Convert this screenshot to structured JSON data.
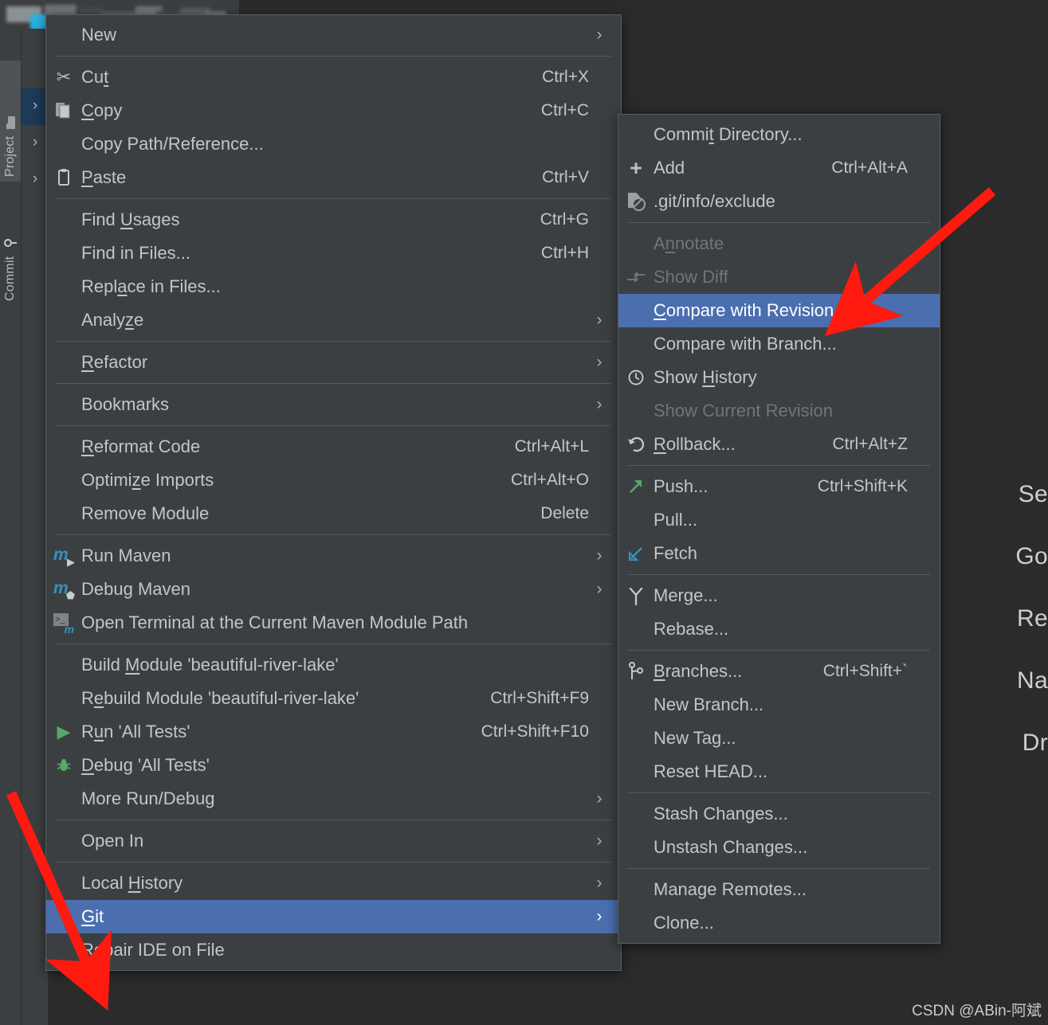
{
  "app": {
    "background_color": "#2b2b2b",
    "menu_background": "#3c3f41",
    "highlight_color": "#4b6eaf",
    "text_color": "#bfc6cc",
    "disabled_color": "#6e7579",
    "annotation_color": "#ff1a0f"
  },
  "sidebar": {
    "tool_windows": [
      {
        "label": "Project",
        "icon": "folder-icon",
        "selected": true
      },
      {
        "label": "Commit",
        "icon": "commit-icon",
        "selected": false
      }
    ],
    "tree_chevrons": [
      "›",
      "›",
      "›"
    ]
  },
  "editor": {
    "hints": [
      "Se",
      "Go",
      "Re",
      "Na",
      "Dr"
    ]
  },
  "watermark": "CSDN @ABin-阿斌",
  "context_menu": {
    "name": "project-context-menu",
    "groups": [
      {
        "items": [
          {
            "label": "New",
            "accel": "",
            "icon": "",
            "submenu": true,
            "mnemonic": "",
            "state": "normal"
          }
        ]
      },
      {
        "items": [
          {
            "label": "Cut",
            "accel": "Ctrl+X",
            "icon": "scissors-icon",
            "submenu": false,
            "mnemonic": "t",
            "state": "normal"
          },
          {
            "label": "Copy",
            "accel": "Ctrl+C",
            "icon": "copy-icon",
            "submenu": false,
            "mnemonic": "C",
            "state": "normal"
          },
          {
            "label": "Copy Path/Reference...",
            "accel": "",
            "icon": "",
            "submenu": false,
            "mnemonic": "",
            "state": "normal"
          },
          {
            "label": "Paste",
            "accel": "Ctrl+V",
            "icon": "paste-icon",
            "submenu": false,
            "mnemonic": "P",
            "state": "normal"
          }
        ]
      },
      {
        "items": [
          {
            "label": "Find Usages",
            "accel": "Ctrl+G",
            "icon": "",
            "submenu": false,
            "mnemonic": "U",
            "state": "normal"
          },
          {
            "label": "Find in Files...",
            "accel": "Ctrl+H",
            "icon": "",
            "submenu": false,
            "mnemonic": "",
            "state": "normal"
          },
          {
            "label": "Replace in Files...",
            "accel": "",
            "icon": "",
            "submenu": false,
            "mnemonic": "a",
            "state": "normal"
          },
          {
            "label": "Analyze",
            "accel": "",
            "icon": "",
            "submenu": true,
            "mnemonic": "z",
            "state": "normal"
          }
        ]
      },
      {
        "items": [
          {
            "label": "Refactor",
            "accel": "",
            "icon": "",
            "submenu": true,
            "mnemonic": "R",
            "state": "normal"
          }
        ]
      },
      {
        "items": [
          {
            "label": "Bookmarks",
            "accel": "",
            "icon": "",
            "submenu": true,
            "mnemonic": "",
            "state": "normal"
          }
        ]
      },
      {
        "items": [
          {
            "label": "Reformat Code",
            "accel": "Ctrl+Alt+L",
            "icon": "",
            "submenu": false,
            "mnemonic": "R",
            "state": "normal"
          },
          {
            "label": "Optimize Imports",
            "accel": "Ctrl+Alt+O",
            "icon": "",
            "submenu": false,
            "mnemonic": "z",
            "state": "normal"
          },
          {
            "label": "Remove Module",
            "accel": "Delete",
            "icon": "",
            "submenu": false,
            "mnemonic": "",
            "state": "normal"
          }
        ]
      },
      {
        "items": [
          {
            "label": "Run Maven",
            "accel": "",
            "icon": "maven-run-icon",
            "submenu": true,
            "mnemonic": "",
            "state": "normal"
          },
          {
            "label": "Debug Maven",
            "accel": "",
            "icon": "maven-debug-icon",
            "submenu": true,
            "mnemonic": "",
            "state": "normal"
          },
          {
            "label": "Open Terminal at the Current Maven Module Path",
            "accel": "",
            "icon": "maven-terminal-icon",
            "submenu": false,
            "mnemonic": "",
            "state": "normal"
          }
        ]
      },
      {
        "items": [
          {
            "label": "Build Module 'beautiful-river-lake'",
            "accel": "",
            "icon": "",
            "submenu": false,
            "mnemonic": "M",
            "state": "normal"
          },
          {
            "label": "Rebuild Module 'beautiful-river-lake'",
            "accel": "Ctrl+Shift+F9",
            "icon": "",
            "submenu": false,
            "mnemonic": "e",
            "state": "normal"
          },
          {
            "label": "Run 'All Tests'",
            "accel": "Ctrl+Shift+F10",
            "icon": "run-icon",
            "submenu": false,
            "mnemonic": "u",
            "state": "normal"
          },
          {
            "label": "Debug 'All Tests'",
            "accel": "",
            "icon": "debug-icon",
            "submenu": false,
            "mnemonic": "D",
            "state": "normal"
          },
          {
            "label": "More Run/Debug",
            "accel": "",
            "icon": "",
            "submenu": true,
            "mnemonic": "",
            "state": "normal"
          }
        ]
      },
      {
        "items": [
          {
            "label": "Open In",
            "accel": "",
            "icon": "",
            "submenu": true,
            "mnemonic": "",
            "state": "normal"
          }
        ]
      },
      {
        "items": [
          {
            "label": "Local History",
            "accel": "",
            "icon": "",
            "submenu": true,
            "mnemonic": "H",
            "state": "normal"
          },
          {
            "label": "Git",
            "accel": "",
            "icon": "",
            "submenu": true,
            "mnemonic": "G",
            "state": "selected"
          },
          {
            "label": "Repair IDE on File",
            "accel": "",
            "icon": "",
            "submenu": false,
            "mnemonic": "",
            "state": "normal"
          }
        ]
      }
    ]
  },
  "git_submenu": {
    "name": "git-submenu",
    "groups": [
      {
        "items": [
          {
            "label": "Commit Directory...",
            "accel": "",
            "icon": "",
            "submenu": false,
            "mnemonic": "t",
            "state": "normal"
          },
          {
            "label": "Add",
            "accel": "Ctrl+Alt+A",
            "icon": "plus-icon",
            "submenu": false,
            "mnemonic": "",
            "state": "normal"
          },
          {
            "label": ".git/info/exclude",
            "accel": "",
            "icon": "gitignore-icon",
            "submenu": false,
            "mnemonic": "",
            "state": "normal"
          }
        ]
      },
      {
        "items": [
          {
            "label": "Annotate",
            "accel": "",
            "icon": "",
            "submenu": false,
            "mnemonic": "n",
            "state": "disabled"
          },
          {
            "label": "Show Diff",
            "accel": "",
            "icon": "show-diff-icon",
            "submenu": false,
            "mnemonic": "",
            "state": "disabled"
          },
          {
            "label": "Compare with Revision...",
            "accel": "",
            "icon": "",
            "submenu": false,
            "mnemonic": "C",
            "state": "selected"
          },
          {
            "label": "Compare with Branch...",
            "accel": "",
            "icon": "",
            "submenu": false,
            "mnemonic": "",
            "state": "normal"
          },
          {
            "label": "Show History",
            "accel": "",
            "icon": "clock-icon",
            "submenu": false,
            "mnemonic": "H",
            "state": "normal"
          },
          {
            "label": "Show Current Revision",
            "accel": "",
            "icon": "",
            "submenu": false,
            "mnemonic": "",
            "state": "disabled"
          },
          {
            "label": "Rollback...",
            "accel": "Ctrl+Alt+Z",
            "icon": "rollback-icon",
            "submenu": false,
            "mnemonic": "R",
            "state": "normal"
          }
        ]
      },
      {
        "items": [
          {
            "label": "Push...",
            "accel": "Ctrl+Shift+K",
            "icon": "push-icon",
            "submenu": false,
            "mnemonic": "",
            "state": "normal"
          },
          {
            "label": "Pull...",
            "accel": "",
            "icon": "",
            "submenu": false,
            "mnemonic": "",
            "state": "normal"
          },
          {
            "label": "Fetch",
            "accel": "",
            "icon": "fetch-icon",
            "submenu": false,
            "mnemonic": "",
            "state": "normal"
          }
        ]
      },
      {
        "items": [
          {
            "label": "Merge...",
            "accel": "",
            "icon": "merge-icon",
            "submenu": false,
            "mnemonic": "",
            "state": "normal"
          },
          {
            "label": "Rebase...",
            "accel": "",
            "icon": "",
            "submenu": false,
            "mnemonic": "",
            "state": "normal"
          }
        ]
      },
      {
        "items": [
          {
            "label": "Branches...",
            "accel": "Ctrl+Shift+`",
            "icon": "branch-icon",
            "submenu": false,
            "mnemonic": "B",
            "state": "normal"
          },
          {
            "label": "New Branch...",
            "accel": "",
            "icon": "",
            "submenu": false,
            "mnemonic": "",
            "state": "normal"
          },
          {
            "label": "New Tag...",
            "accel": "",
            "icon": "",
            "submenu": false,
            "mnemonic": "",
            "state": "normal"
          },
          {
            "label": "Reset HEAD...",
            "accel": "",
            "icon": "",
            "submenu": false,
            "mnemonic": "",
            "state": "normal"
          }
        ]
      },
      {
        "items": [
          {
            "label": "Stash Changes...",
            "accel": "",
            "icon": "",
            "submenu": false,
            "mnemonic": "",
            "state": "normal"
          },
          {
            "label": "Unstash Changes...",
            "accel": "",
            "icon": "",
            "submenu": false,
            "mnemonic": "",
            "state": "normal"
          }
        ]
      },
      {
        "items": [
          {
            "label": "Manage Remotes...",
            "accel": "",
            "icon": "",
            "submenu": false,
            "mnemonic": "",
            "state": "normal"
          },
          {
            "label": "Clone...",
            "accel": "",
            "icon": "",
            "submenu": false,
            "mnemonic": "",
            "state": "normal"
          }
        ]
      }
    ]
  },
  "annotations": [
    {
      "name": "arrow-to-git",
      "target": "Git"
    },
    {
      "name": "arrow-to-compare-with-revision",
      "target": "Compare with Revision..."
    }
  ]
}
